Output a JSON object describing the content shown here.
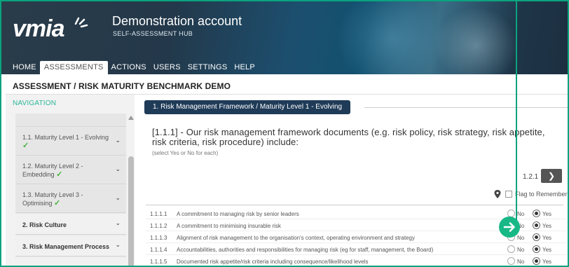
{
  "colors": {
    "accent_teal": "#0aa37f",
    "header_dark": "#23384a",
    "section_pill": "#1f3b58",
    "check_green": "#45b03b",
    "arrow_green": "#17b886"
  },
  "brand": {
    "logo_text": "vmia",
    "account_title": "Demonstration account",
    "account_subtitle": "SELF-ASSESSMENT HUB"
  },
  "topnav": {
    "items": [
      "HOME",
      "ASSESSMENTS",
      "ACTIONS",
      "USERS",
      "SETTINGS",
      "HELP"
    ],
    "active": "ASSESSMENTS"
  },
  "breadcrumb": "ASSESSMENT / RISK MATURITY BENCHMARK DEMO",
  "sidebar": {
    "title": "NAVIGATION",
    "items": [
      {
        "label": "1.1. Maturity Level 1 - Evolving",
        "check": "✓"
      },
      {
        "label": "1.2. Maturity Level 2 - Embedding",
        "check": "✓"
      },
      {
        "label": "1.3. Maturity Level 3 - Optimising",
        "check": "✓"
      },
      {
        "label": "2. Risk Culture"
      },
      {
        "label": "3. Risk Management Process"
      }
    ]
  },
  "main": {
    "section_title": "1. Risk Management Framework / Maturity Level 1 - Evolving",
    "question": "[1.1.1] - Our risk management framework documents (e.g. risk policy, risk strategy, risk appetite, risk criteria, risk procedure) include:",
    "hint": "(select Yes or No for each)",
    "page_ref": "1.2.1",
    "next_icon": "chevron-right-icon",
    "flag_label": "Flag to Remember",
    "radio_no": "No",
    "radio_yes": "Yes",
    "rows": [
      {
        "num": "1.1.1.1",
        "text": "A commitment to managing risk by senior leaders",
        "value": "Yes"
      },
      {
        "num": "1.1.1.2",
        "text": "A commitment to minimising insurable risk",
        "value": "Yes"
      },
      {
        "num": "1.1.1.3",
        "text": "Alignment of risk management to the organisation's context, operating environment and strategy",
        "value": "Yes"
      },
      {
        "num": "1.1.1.4",
        "text": "Accountabilities, authorities and responsibilities for managing risk (eg for staff, management, the Board)",
        "value": "Yes"
      },
      {
        "num": "1.1.1.5",
        "text": "Documented risk appetite/risk criteria including consequence/likelihood levels",
        "value": "Yes"
      }
    ]
  }
}
